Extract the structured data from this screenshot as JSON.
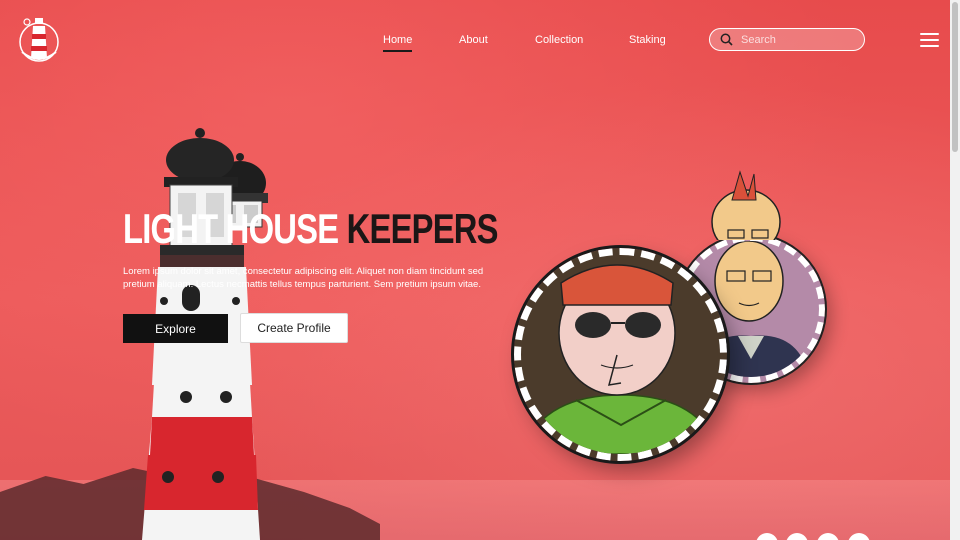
{
  "nav": {
    "items": [
      {
        "label": "Home",
        "active": true
      },
      {
        "label": "About",
        "active": false
      },
      {
        "label": "Collection",
        "active": false
      },
      {
        "label": "Staking",
        "active": false
      }
    ]
  },
  "search": {
    "placeholder": "Search"
  },
  "hero": {
    "title_light": "LIGHT HOUSE",
    "title_dark": "KEEPERS",
    "description": "Lorem ipsum dolor sit amet, consectetur adipiscing elit. Aliquet non diam tincidunt sed pretium aliquam. Lectus necmattis tellus tempus parturient. Sem pretium ipsum vitae.",
    "explore_label": "Explore",
    "create_profile_label": "Create Profile"
  },
  "colors": {
    "background": "#e8504f",
    "accent_dark": "#1c1616",
    "button_dark": "#111111"
  },
  "icons": [
    "lighthouse-logo-icon",
    "search-icon",
    "hamburger-menu-icon"
  ]
}
